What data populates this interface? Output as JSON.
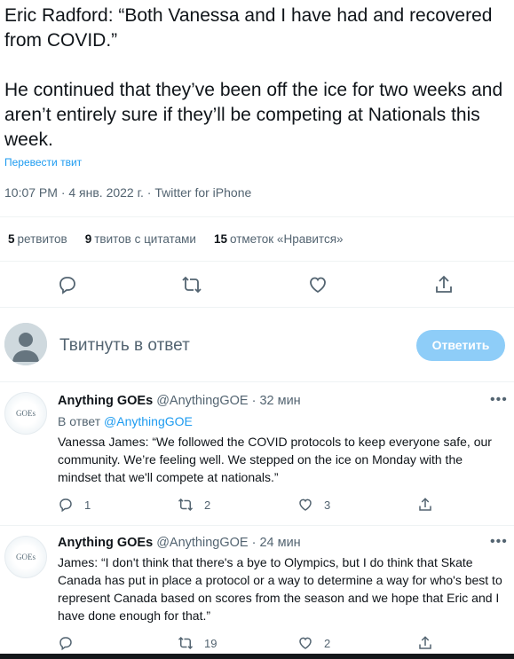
{
  "tweet": {
    "paragraph1": "Eric Radford: “Both Vanessa and I have had and recovered from COVID.”",
    "paragraph2": "He continued that they’ve been off the ice for two weeks and aren’t entirely sure if they’ll be competing at Nationals this week.",
    "translate_label": "Перевести твит",
    "meta": "10:07 PM · 4 янв. 2022 г. · Twitter for iPhone"
  },
  "stats": {
    "retweets_count": "5",
    "retweets_label": "ретвитов",
    "quotes_count": "9",
    "quotes_label": "твитов с цитатами",
    "likes_count": "15",
    "likes_label": "отметок «Нравится»"
  },
  "compose": {
    "placeholder": "Твитнуть в ответ",
    "reply_button": "Ответить"
  },
  "replies": [
    {
      "avatar_text": "GOEs",
      "name": "Anything GOEs",
      "handle": "@AnythingGOE · 32 мин",
      "in_reply_prefix": "В ответ",
      "in_reply_handle": "@AnythingGOE",
      "body": "Vanessa James: “We followed the COVID protocols to keep everyone safe, our community. We’re feeling well. We stepped on the ice on Monday with the mindset that we'll compete at nationals.”",
      "reply_count": "1",
      "retweet_count": "2",
      "like_count": "3"
    },
    {
      "avatar_text": "GOEs",
      "name": "Anything GOEs",
      "handle": "@AnythingGOE · 24 мин",
      "body": "James: “I don't think that there's a bye to Olympics, but I do think that Skate Canada has put in place a protocol or a way to determine a way for who's best to represent Canada based on scores from the season and we hope that Eric and I have done enough for that.”",
      "reply_count": "0",
      "retweet_count": "19",
      "like_count": "2"
    }
  ],
  "colors": {
    "accent": "#1d9bf0",
    "reply_button_disabled": "#8ecdf8",
    "secondary_text": "#536471"
  }
}
